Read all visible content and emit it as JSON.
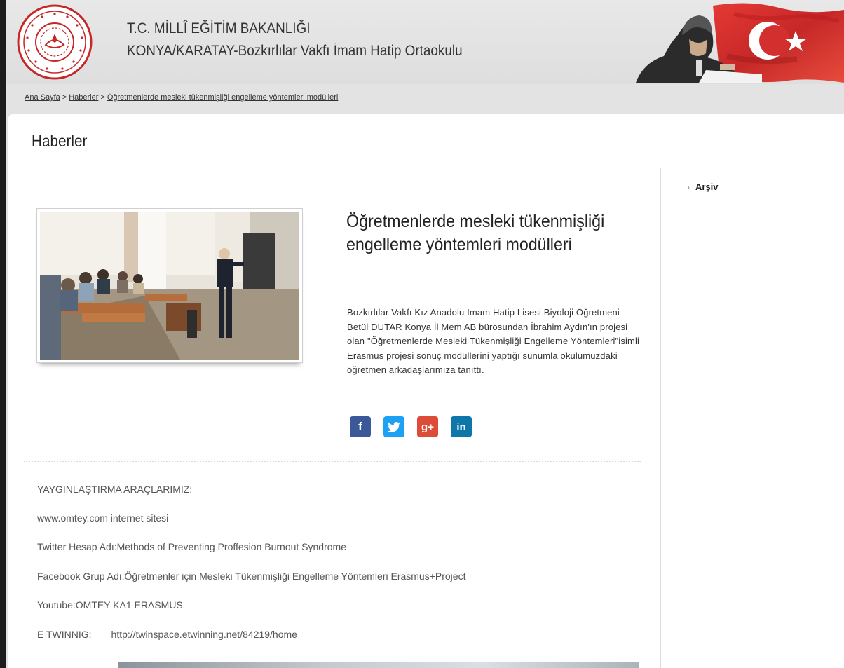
{
  "header": {
    "title_line1": "T.C. MİLLÎ EĞİTİM BAKANLIĞI",
    "title_line2": "KONYA/KARATAY-Bozkırlılar Vakfı İmam Hatip Ortaokulu",
    "logo_icon": "meb-seal-logo",
    "banner_icon": "ataturk-flag-banner"
  },
  "breadcrumb": {
    "items": [
      "Ana Sayfa",
      "Haberler",
      "Öğretmenlerde mesleki tükenmişliği engelleme yöntemleri modülleri"
    ],
    "separator": ">"
  },
  "page": {
    "heading": "Haberler"
  },
  "sidebar": {
    "archive_label": "Arşiv",
    "archive_icon": "chevron-right-icon"
  },
  "news": {
    "title": "Öğretmenlerde mesleki tükenmişliği engelleme yöntemleri modülleri",
    "body": "Bozkırlılar Vakfı Kız Anadolu İmam Hatip Lisesi Biyoloji Öğretmeni Betül DUTAR Konya İl Mem AB bürosundan İbrahim Aydın'ın projesi olan \"Öğretmenlerde Mesleki Tükenmişliği Engelleme Yöntemleri\"isimli Erasmus projesi sonuç modüllerini yaptığı sunumla okulumuzdaki öğretmen arkadaşlarımıza tanıttı.",
    "social": [
      {
        "icon": "facebook-icon",
        "glyph": "f",
        "color": "#3b5998"
      },
      {
        "icon": "twitter-icon",
        "glyph": "t",
        "color": "#1da1f2"
      },
      {
        "icon": "google-plus-icon",
        "glyph": "g+",
        "color": "#dd4b39"
      },
      {
        "icon": "linkedin-icon",
        "glyph": "in",
        "color": "#0e76a8"
      }
    ]
  },
  "dissemination": {
    "heading": "YAYGINLAŞTIRMA ARAÇLARIMIZ:",
    "website": "www.omtey.com internet sitesi",
    "twitter": "Twitter Hesap Adı:Methods of Preventing Proffesion Burnout Syndrome",
    "facebook": "Facebook Grup Adı:Öğretmenler için Mesleki Tükenmişliği Engelleme Yöntemleri Erasmus+Project",
    "youtube": "Youtube:OMTEY KA1 ERASMUS",
    "etwinning_label": "E TWINNIG:",
    "etwinning_url": "http://twinspace.etwinning.net/84219/home"
  }
}
